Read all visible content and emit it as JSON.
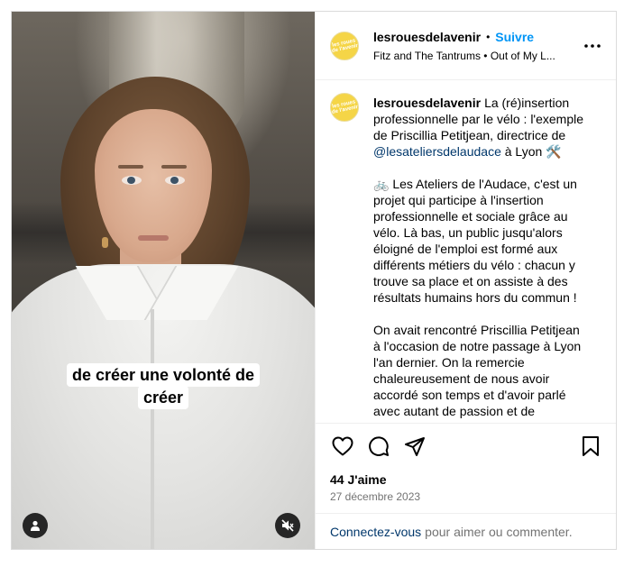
{
  "media": {
    "caption_lines": [
      "de créer une volonté de",
      "créer"
    ],
    "user_tag_icon": "user-icon",
    "mute_icon": "speaker-muted-icon"
  },
  "header": {
    "avatar_text": "les roues de l'avenir",
    "username": "lesrouesdelavenir",
    "separator": "•",
    "follow_label": "Suivre",
    "audio": "Fitz and The Tantrums • Out of My L...",
    "more_icon": "more-horizontal-icon"
  },
  "caption": {
    "username": "lesrouesdelavenir",
    "intro_before_mention": "La (ré)insertion professionnelle par le vélo : l'exemple de Priscillia Petitjean, directrice de ",
    "mention": "@lesateliersdelaudace",
    "intro_after_mention": " à Lyon 🛠️",
    "paragraph2": "🚲 Les Ateliers de l'Audace, c'est un projet qui participe à l'insertion professionnelle et sociale grâce au vélo. Là bas, un public jusqu'alors éloigné de l'emploi est formé aux différents métiers du vélo : chacun y trouve sa place et on assiste à des résultats humains hors du commun !",
    "paragraph3": "On avait rencontré Priscillia Petitjean à l'occasion de notre passage à Lyon l'an dernier. On la remercie chaleureusement de nous avoir accordé son temps et d'avoir parlé avec autant de passion et de"
  },
  "actions": {
    "like_icon": "heart-icon",
    "comment_icon": "comment-icon",
    "share_icon": "share-icon",
    "save_icon": "bookmark-icon"
  },
  "likes": "44 J'aime",
  "date": "27 décembre 2023",
  "login": {
    "link": "Connectez-vous",
    "text": "pour aimer ou commenter."
  },
  "colors": {
    "accent": "#0095f6",
    "mention": "#00376b",
    "muted": "#737373",
    "avatar": "#f5d547"
  }
}
